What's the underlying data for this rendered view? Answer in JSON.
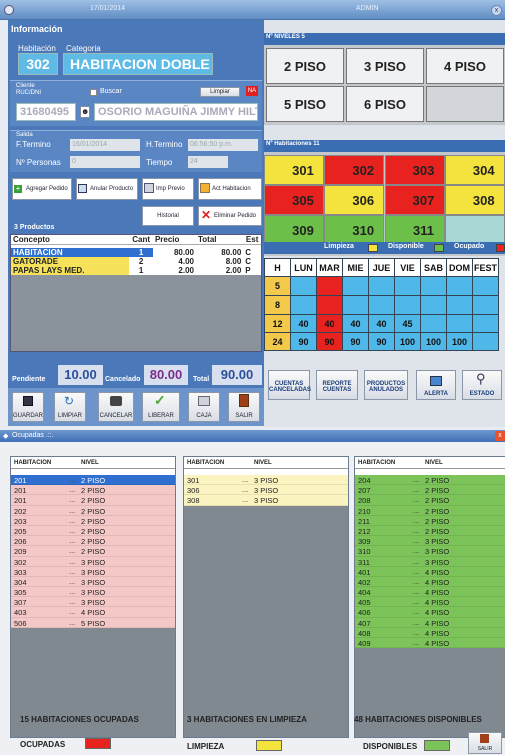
{
  "titlebar": {
    "date": "17/01/2014",
    "user": "ADMIN"
  },
  "info": {
    "title": "Información",
    "habitacion_label": "Habitación",
    "categoria_label": "Categoria",
    "habitacion": "302",
    "categoria": "HABITACION DOBLE",
    "cliente_label": "Cliente",
    "ruc_label": "RUC/DNI",
    "buscar_label": "Buscar",
    "limpiar_label": "Limpiar",
    "badge": "NA",
    "dni": "31680495",
    "cliente_nombre": "OSORIO MAGUIÑA JIMMY HILTON",
    "salida_label": "Salida",
    "ftermino_label": "F.Termino",
    "ftermino": "16/01/2014",
    "htermino_label": "H.Termino",
    "htermino": "06:56:50 p.m.",
    "npersonas_label": "Nº Personas",
    "npersonas": "0",
    "tiempo_label": "Tiempo",
    "tiempo": "24"
  },
  "actions": {
    "agregar": "Agregar Pedido",
    "anular": "Anular Producto",
    "imp": "Imp Previo",
    "act": "Act Habitacion",
    "historial": "Historial",
    "eliminar": "Eliminar Pedido"
  },
  "productos": {
    "title": "3 Productos",
    "headers": [
      "Concepto",
      "Cant",
      "Precio",
      "Total",
      "Est"
    ],
    "rows": [
      {
        "concepto": "HABITACION",
        "cant": "1",
        "precio": "80.00",
        "total": "80.00",
        "est": "C"
      },
      {
        "concepto": "GATORADE",
        "cant": "2",
        "precio": "4.00",
        "total": "8.00",
        "est": "C"
      },
      {
        "concepto": "PAPAS LAYS MED.",
        "cant": "1",
        "precio": "2.00",
        "total": "2.00",
        "est": "P"
      }
    ]
  },
  "totals": {
    "pendiente_label": "Pendiente",
    "pendiente": "10.00",
    "cancelado_label": "Cancelado",
    "cancelado": "80.00",
    "total_label": "Total",
    "total": "90.00"
  },
  "bottom_buttons": [
    "GUARDAR",
    "LIMPIAR",
    "CANCELAR",
    "LIBERAR",
    "CAJA",
    "SALIR"
  ],
  "niveles": {
    "title": "Nº NIVELES 5",
    "items": [
      "2 PISO",
      "3 PISO",
      "4 PISO",
      "5 PISO",
      "6 PISO",
      ""
    ]
  },
  "habitaciones": {
    "title": "Nº Habitaciones 11",
    "rooms": [
      {
        "n": "301",
        "color": "#f4e33c"
      },
      {
        "n": "302",
        "color": "#e8231f"
      },
      {
        "n": "303",
        "color": "#e8231f"
      },
      {
        "n": "304",
        "color": "#f4e33c"
      },
      {
        "n": "305",
        "color": "#e8231f"
      },
      {
        "n": "306",
        "color": "#f4e33c"
      },
      {
        "n": "307",
        "color": "#e8231f"
      },
      {
        "n": "308",
        "color": "#f4e33c"
      },
      {
        "n": "309",
        "color": "#6cc04a"
      },
      {
        "n": "310",
        "color": "#6cc04a"
      },
      {
        "n": "311",
        "color": "#6cc04a"
      },
      {
        "n": "",
        "color": "#a8d8d6"
      }
    ]
  },
  "legend_top": {
    "limpieza": "Limpieza",
    "disponible": "Disponible",
    "ocupado": "Ocupado",
    "colors": {
      "limpieza": "#f4e33c",
      "disponible": "#6cc04a",
      "ocupado": "#e8231f"
    }
  },
  "tarifas": {
    "headers": [
      "H",
      "LUN",
      "MAR",
      "MIE",
      "JUE",
      "VIE",
      "SAB",
      "DOM",
      "FEST"
    ],
    "rows": [
      [
        "5",
        "",
        "",
        "",
        "",
        "",
        "",
        "",
        ""
      ],
      [
        "8",
        "",
        "",
        "",
        "",
        "",
        "",
        "",
        ""
      ],
      [
        "12",
        "40",
        "40",
        "40",
        "40",
        "45",
        "",
        "",
        ""
      ],
      [
        "24",
        "90",
        "90",
        "90",
        "90",
        "100",
        "100",
        "100",
        ""
      ]
    ]
  },
  "right_buttons": [
    "CUENTAS CANCELADAS",
    "REPORTE CUENTAS",
    "PRODUCTOS ANULADOS",
    "ALERTA",
    "ESTADO"
  ],
  "ocupadas": {
    "title": "Ocupadas .::.",
    "col_hab": "HABITACION",
    "col_nivel": "NIVEL",
    "ocup": [
      [
        "201",
        "2 PISO"
      ],
      [
        "201",
        "2 PISO"
      ],
      [
        "201",
        "2 PISO"
      ],
      [
        "202",
        "2 PISO"
      ],
      [
        "203",
        "2 PISO"
      ],
      [
        "205",
        "2 PISO"
      ],
      [
        "206",
        "2 PISO"
      ],
      [
        "209",
        "2 PISO"
      ],
      [
        "302",
        "3 PISO"
      ],
      [
        "303",
        "3 PISO"
      ],
      [
        "304",
        "3 PISO"
      ],
      [
        "305",
        "3 PISO"
      ],
      [
        "307",
        "3 PISO"
      ],
      [
        "403",
        "4 PISO"
      ],
      [
        "506",
        "5 PISO"
      ]
    ],
    "limp": [
      [
        "301",
        "3 PISO"
      ],
      [
        "306",
        "3 PISO"
      ],
      [
        "308",
        "3 PISO"
      ]
    ],
    "disp": [
      [
        "204",
        "2 PISO"
      ],
      [
        "207",
        "2 PISO"
      ],
      [
        "208",
        "2 PISO"
      ],
      [
        "210",
        "2 PISO"
      ],
      [
        "211",
        "2 PISO"
      ],
      [
        "212",
        "2 PISO"
      ],
      [
        "309",
        "3 PISO"
      ],
      [
        "310",
        "3 PISO"
      ],
      [
        "311",
        "3 PISO"
      ],
      [
        "401",
        "4 PISO"
      ],
      [
        "402",
        "4 PISO"
      ],
      [
        "404",
        "4 PISO"
      ],
      [
        "405",
        "4 PISO"
      ],
      [
        "406",
        "4 PISO"
      ],
      [
        "407",
        "4 PISO"
      ],
      [
        "408",
        "4 PISO"
      ],
      [
        "409",
        "4 PISO"
      ]
    ],
    "count_ocup": "15 HABITACIONES OCUPADAS",
    "count_limp": "3 HABITACIONES EN LIMPIEZA",
    "count_disp": "48 HABITACIONES DISPONIBLES",
    "leg_ocup": "OCUPADAS",
    "leg_limp": "LIMPIEZA",
    "leg_disp": "DISPONIBLES",
    "salir": "SALIR",
    "colors": {
      "ocup": "#f5c8c8",
      "limp": "#fbf3c0",
      "disp": "#7cc35a",
      "ocup_sel": "#2e6fd0",
      "leg_ocup": "#e8231f",
      "leg_limp": "#f4e33c",
      "leg_disp": "#7cc35a"
    }
  }
}
